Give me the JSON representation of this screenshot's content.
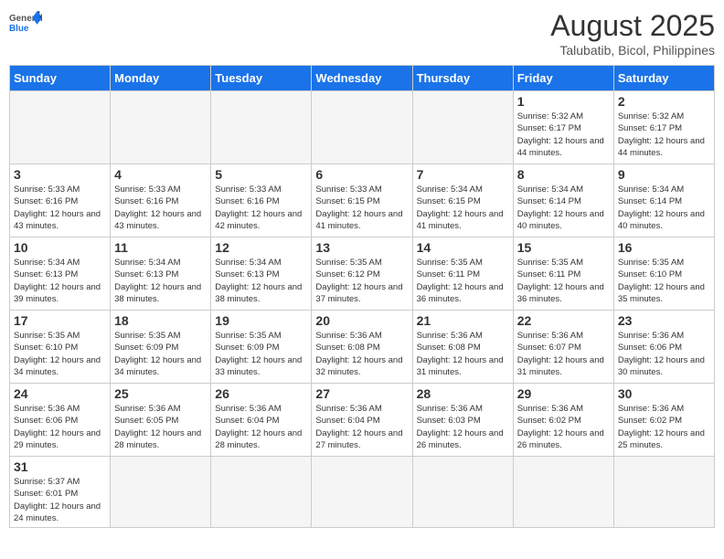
{
  "header": {
    "logo_general": "General",
    "logo_blue": "Blue",
    "month_year": "August 2025",
    "location": "Talubatib, Bicol, Philippines"
  },
  "days_of_week": [
    "Sunday",
    "Monday",
    "Tuesday",
    "Wednesday",
    "Thursday",
    "Friday",
    "Saturday"
  ],
  "weeks": [
    [
      {
        "day": "",
        "empty": true
      },
      {
        "day": "",
        "empty": true
      },
      {
        "day": "",
        "empty": true
      },
      {
        "day": "",
        "empty": true
      },
      {
        "day": "",
        "empty": true
      },
      {
        "day": "1",
        "sunrise": "5:32 AM",
        "sunset": "6:17 PM",
        "daylight": "12 hours and 44 minutes."
      },
      {
        "day": "2",
        "sunrise": "5:32 AM",
        "sunset": "6:17 PM",
        "daylight": "12 hours and 44 minutes."
      }
    ],
    [
      {
        "day": "3",
        "sunrise": "5:33 AM",
        "sunset": "6:16 PM",
        "daylight": "12 hours and 43 minutes."
      },
      {
        "day": "4",
        "sunrise": "5:33 AM",
        "sunset": "6:16 PM",
        "daylight": "12 hours and 43 minutes."
      },
      {
        "day": "5",
        "sunrise": "5:33 AM",
        "sunset": "6:16 PM",
        "daylight": "12 hours and 42 minutes."
      },
      {
        "day": "6",
        "sunrise": "5:33 AM",
        "sunset": "6:15 PM",
        "daylight": "12 hours and 41 minutes."
      },
      {
        "day": "7",
        "sunrise": "5:34 AM",
        "sunset": "6:15 PM",
        "daylight": "12 hours and 41 minutes."
      },
      {
        "day": "8",
        "sunrise": "5:34 AM",
        "sunset": "6:14 PM",
        "daylight": "12 hours and 40 minutes."
      },
      {
        "day": "9",
        "sunrise": "5:34 AM",
        "sunset": "6:14 PM",
        "daylight": "12 hours and 40 minutes."
      }
    ],
    [
      {
        "day": "10",
        "sunrise": "5:34 AM",
        "sunset": "6:13 PM",
        "daylight": "12 hours and 39 minutes."
      },
      {
        "day": "11",
        "sunrise": "5:34 AM",
        "sunset": "6:13 PM",
        "daylight": "12 hours and 38 minutes."
      },
      {
        "day": "12",
        "sunrise": "5:34 AM",
        "sunset": "6:13 PM",
        "daylight": "12 hours and 38 minutes."
      },
      {
        "day": "13",
        "sunrise": "5:35 AM",
        "sunset": "6:12 PM",
        "daylight": "12 hours and 37 minutes."
      },
      {
        "day": "14",
        "sunrise": "5:35 AM",
        "sunset": "6:11 PM",
        "daylight": "12 hours and 36 minutes."
      },
      {
        "day": "15",
        "sunrise": "5:35 AM",
        "sunset": "6:11 PM",
        "daylight": "12 hours and 36 minutes."
      },
      {
        "day": "16",
        "sunrise": "5:35 AM",
        "sunset": "6:10 PM",
        "daylight": "12 hours and 35 minutes."
      }
    ],
    [
      {
        "day": "17",
        "sunrise": "5:35 AM",
        "sunset": "6:10 PM",
        "daylight": "12 hours and 34 minutes."
      },
      {
        "day": "18",
        "sunrise": "5:35 AM",
        "sunset": "6:09 PM",
        "daylight": "12 hours and 34 minutes."
      },
      {
        "day": "19",
        "sunrise": "5:35 AM",
        "sunset": "6:09 PM",
        "daylight": "12 hours and 33 minutes."
      },
      {
        "day": "20",
        "sunrise": "5:36 AM",
        "sunset": "6:08 PM",
        "daylight": "12 hours and 32 minutes."
      },
      {
        "day": "21",
        "sunrise": "5:36 AM",
        "sunset": "6:08 PM",
        "daylight": "12 hours and 31 minutes."
      },
      {
        "day": "22",
        "sunrise": "5:36 AM",
        "sunset": "6:07 PM",
        "daylight": "12 hours and 31 minutes."
      },
      {
        "day": "23",
        "sunrise": "5:36 AM",
        "sunset": "6:06 PM",
        "daylight": "12 hours and 30 minutes."
      }
    ],
    [
      {
        "day": "24",
        "sunrise": "5:36 AM",
        "sunset": "6:06 PM",
        "daylight": "12 hours and 29 minutes."
      },
      {
        "day": "25",
        "sunrise": "5:36 AM",
        "sunset": "6:05 PM",
        "daylight": "12 hours and 28 minutes."
      },
      {
        "day": "26",
        "sunrise": "5:36 AM",
        "sunset": "6:04 PM",
        "daylight": "12 hours and 28 minutes."
      },
      {
        "day": "27",
        "sunrise": "5:36 AM",
        "sunset": "6:04 PM",
        "daylight": "12 hours and 27 minutes."
      },
      {
        "day": "28",
        "sunrise": "5:36 AM",
        "sunset": "6:03 PM",
        "daylight": "12 hours and 26 minutes."
      },
      {
        "day": "29",
        "sunrise": "5:36 AM",
        "sunset": "6:02 PM",
        "daylight": "12 hours and 26 minutes."
      },
      {
        "day": "30",
        "sunrise": "5:36 AM",
        "sunset": "6:02 PM",
        "daylight": "12 hours and 25 minutes."
      }
    ],
    [
      {
        "day": "31",
        "sunrise": "5:37 AM",
        "sunset": "6:01 PM",
        "daylight": "12 hours and 24 minutes."
      },
      {
        "day": "",
        "empty": true
      },
      {
        "day": "",
        "empty": true
      },
      {
        "day": "",
        "empty": true
      },
      {
        "day": "",
        "empty": true
      },
      {
        "day": "",
        "empty": true
      },
      {
        "day": "",
        "empty": true
      }
    ]
  ]
}
